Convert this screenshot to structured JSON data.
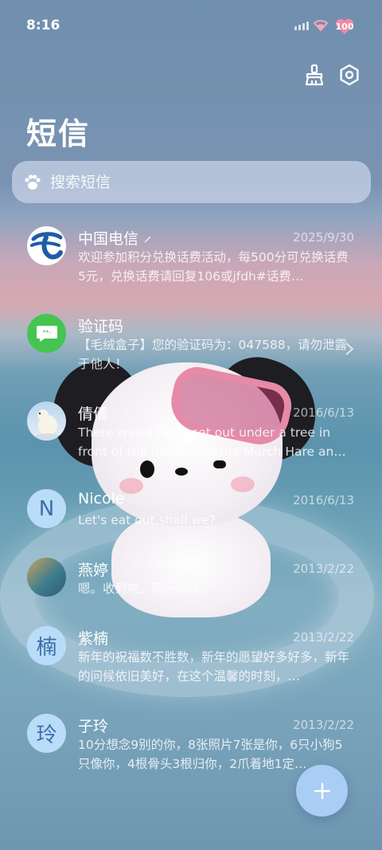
{
  "status_bar": {
    "time": "8:16",
    "battery": "100"
  },
  "header": {
    "title": "短信",
    "clean_icon": "broom-icon",
    "settings_icon": "gear-icon"
  },
  "search": {
    "placeholder": "搜索短信",
    "icon": "paw-icon"
  },
  "messages": [
    {
      "name": "中国电信",
      "date": "2025/9/30",
      "preview": "欢迎参加积分兑换话费活动，每500分可兑换话费5元，兑换话费请回复106或jfdh#话费…",
      "avatar": "china-telecom-logo",
      "name_icon": "pencil-icon"
    },
    {
      "name": "验证码",
      "date": "",
      "preview": "【毛绒盒子】您的验证码为：047588，请勿泄露于他人！",
      "avatar": "chat-bubble-icon"
    },
    {
      "name": "倩倩",
      "date": "2016/6/13",
      "preview": "There was a table set out under a tree in front of the house,and the March Hare an…",
      "avatar": "polar-bear-photo"
    },
    {
      "name": "Nicole",
      "date": "2016/6/13",
      "preview": "Let's eat out,shall we?",
      "avatar_letter": "N"
    },
    {
      "name": "燕婷",
      "date": "2013/2/22",
      "preview": "嗯。收到啦。同乐同乐。",
      "avatar": "landscape-photo"
    },
    {
      "name": "紫楠",
      "date": "2013/2/22",
      "preview": "新年的祝福数不胜数，新年的愿望好多好多，新年的问候依旧美好，在这个温馨的时刻，…",
      "avatar_letter": "楠"
    },
    {
      "name": "子玲",
      "date": "2013/2/22",
      "preview": "10分想念9别的你，8张照片7张是你，6只小狗5只像你，4根骨头3根归你，2爪着地1定…",
      "avatar_letter": "玲"
    }
  ],
  "fab": {
    "icon": "plus-icon"
  },
  "colors": {
    "avatar_letter_bg": "#b9dcf8",
    "avatar_letter_fg": "#3a6ea8",
    "fab_bg": "#a9cdf4",
    "telecom_blue": "#1e5ca8",
    "chat_green": "#46c452"
  }
}
